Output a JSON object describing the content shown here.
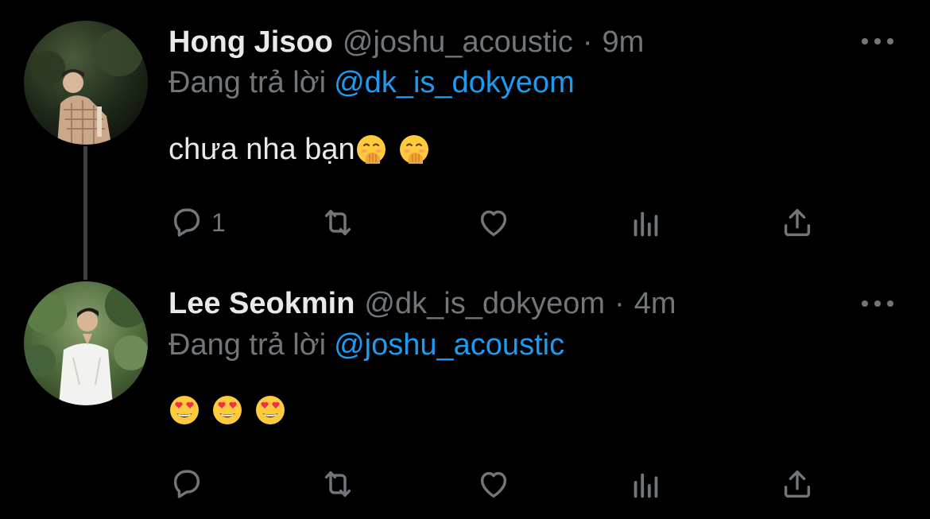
{
  "theme": {
    "background": "#000000",
    "text_primary": "#e7e9ea",
    "text_secondary": "#71767b",
    "link": "#1d9bf0",
    "thread_line": "#3e4144"
  },
  "tweets": [
    {
      "display_name": "Hong Jisoo",
      "handle": "@joshu_acoustic",
      "separator": "·",
      "time": "9m",
      "reply_prefix": "Đang trả lời",
      "reply_to": "@dk_is_dokyeom",
      "text": "chưa nha bạn",
      "emojis": [
        "hand-over-mouth-emoji",
        "hand-over-mouth-emoji"
      ],
      "reply_count": "1",
      "avatar": "avatar-hong-jisoo"
    },
    {
      "display_name": "Lee Seokmin",
      "handle": "@dk_is_dokyeom",
      "separator": "·",
      "time": "4m",
      "reply_prefix": "Đang trả lời",
      "reply_to": "@joshu_acoustic",
      "text": "",
      "emojis": [
        "heart-eyes-emoji",
        "heart-eyes-emoji",
        "heart-eyes-emoji"
      ],
      "reply_count": "",
      "avatar": "avatar-lee-seokmin"
    }
  ],
  "icons": {
    "reply": "reply-icon",
    "retweet": "retweet-icon",
    "like": "heart-icon",
    "views": "analytics-icon",
    "share": "share-icon",
    "more": "more-icon"
  }
}
